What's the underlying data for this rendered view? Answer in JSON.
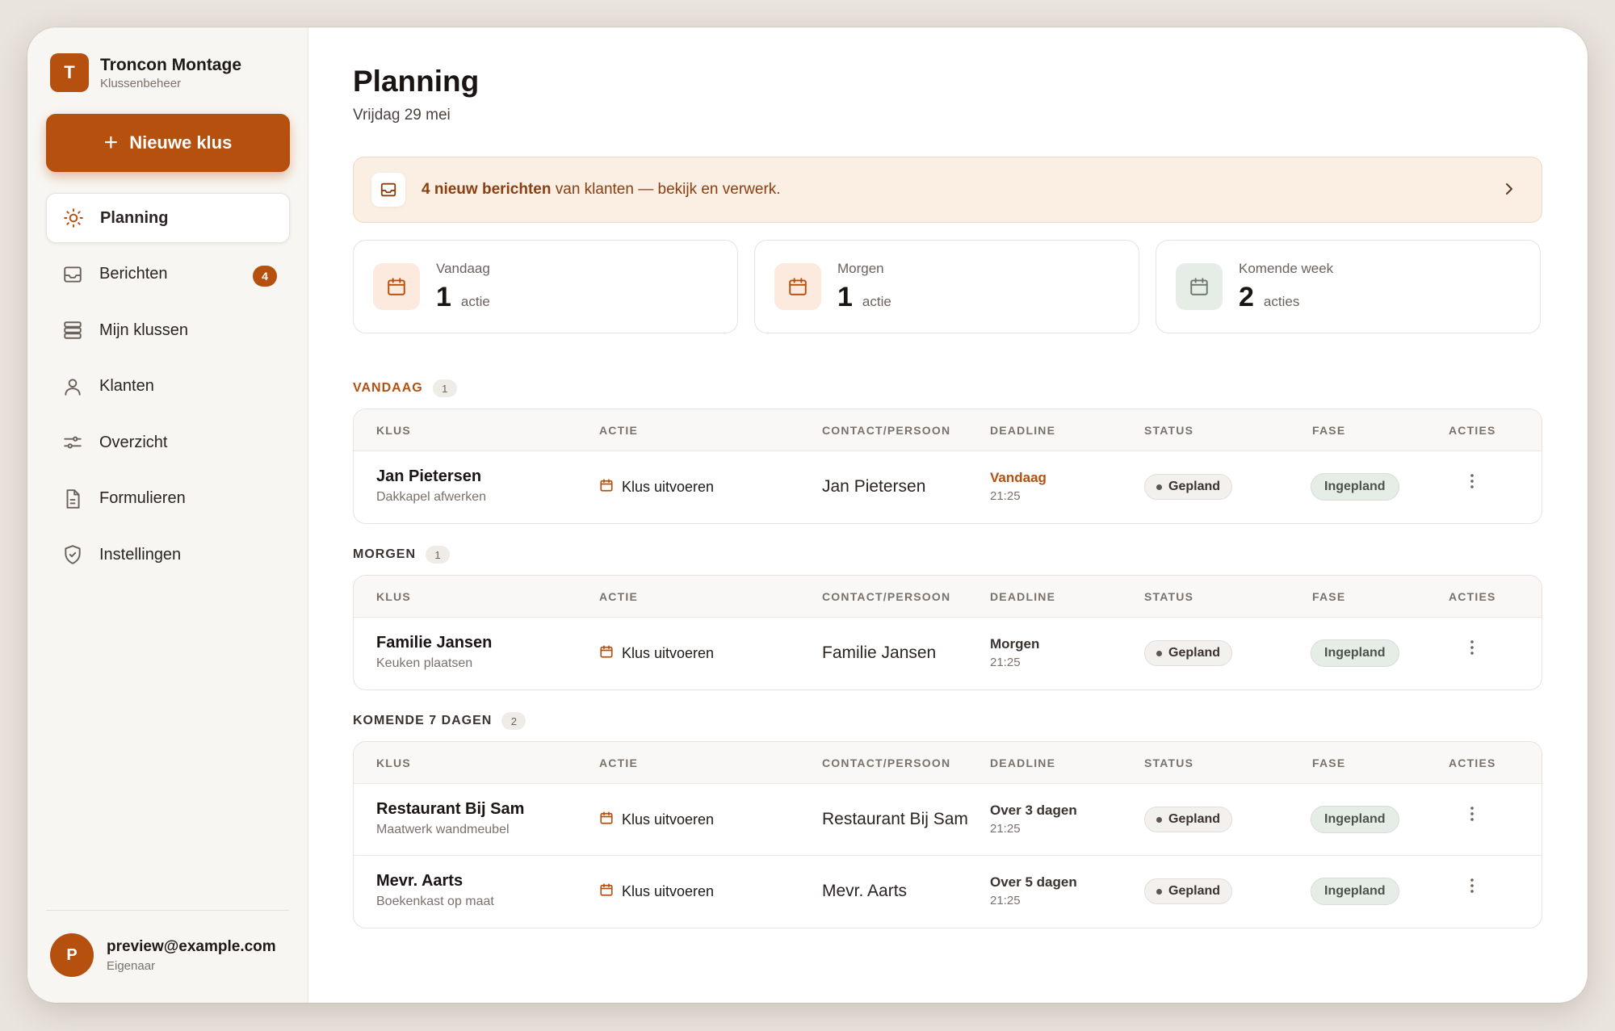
{
  "brand": {
    "initial": "T",
    "name": "Troncon Montage",
    "subtitle": "Klussenbeheer"
  },
  "new_button": {
    "label": "Nieuwe klus"
  },
  "nav": [
    {
      "label": "Planning",
      "icon": "sun-icon",
      "active": true
    },
    {
      "label": "Berichten",
      "icon": "inbox-icon",
      "badge": "4"
    },
    {
      "label": "Mijn klussen",
      "icon": "stack-icon"
    },
    {
      "label": "Klanten",
      "icon": "user-icon"
    },
    {
      "label": "Overzicht",
      "icon": "sliders-icon"
    },
    {
      "label": "Formulieren",
      "icon": "document-icon"
    },
    {
      "label": "Instellingen",
      "icon": "shield-icon"
    }
  ],
  "user": {
    "initial": "P",
    "email": "preview@example.com",
    "role": "Eigenaar"
  },
  "page": {
    "title": "Planning",
    "date": "Vrijdag 29 mei"
  },
  "banner": {
    "bold": "4 nieuw berichten",
    "text": " van klanten — bekijk en verwerk."
  },
  "stats": [
    {
      "label": "Vandaag",
      "value": "1",
      "unit": "actie",
      "tone": "orange"
    },
    {
      "label": "Morgen",
      "value": "1",
      "unit": "actie",
      "tone": "orange"
    },
    {
      "label": "Komende week",
      "value": "2",
      "unit": "acties",
      "tone": "green"
    }
  ],
  "columns": [
    "KLUS",
    "ACTIE",
    "CONTACT/PERSOON",
    "DEADLINE",
    "STATUS",
    "FASE",
    "ACTIES"
  ],
  "colors": {
    "accent": "#b5500f",
    "section_today": "#b5500f",
    "section_other": "#3b332e"
  },
  "sections": [
    {
      "title": "VANDAAG",
      "count": "1",
      "accent": true,
      "rows": [
        {
          "name": "Jan Pietersen",
          "sub": "Dakkapel afwerken",
          "actie": "Klus uitvoeren",
          "contact": "Jan Pietersen",
          "deadline": "Vandaag",
          "time": "21:25",
          "today": true,
          "status": "Gepland",
          "fase": "Ingepland"
        }
      ]
    },
    {
      "title": "MORGEN",
      "count": "1",
      "accent": false,
      "rows": [
        {
          "name": "Familie Jansen",
          "sub": "Keuken plaatsen",
          "actie": "Klus uitvoeren",
          "contact": "Familie Jansen",
          "deadline": "Morgen",
          "time": "21:25",
          "today": false,
          "status": "Gepland",
          "fase": "Ingepland"
        }
      ]
    },
    {
      "title": "KOMENDE 7 DAGEN",
      "count": "2",
      "accent": false,
      "rows": [
        {
          "name": "Restaurant Bij Sam",
          "sub": "Maatwerk wandmeubel",
          "actie": "Klus uitvoeren",
          "contact": "Restaurant Bij Sam",
          "deadline": "Over 3 dagen",
          "time": "21:25",
          "today": false,
          "status": "Gepland",
          "fase": "Ingepland"
        },
        {
          "name": "Mevr. Aarts",
          "sub": "Boekenkast op maat",
          "actie": "Klus uitvoeren",
          "contact": "Mevr. Aarts",
          "deadline": "Over 5 dagen",
          "time": "21:25",
          "today": false,
          "status": "Gepland",
          "fase": "Ingepland"
        }
      ]
    }
  ]
}
